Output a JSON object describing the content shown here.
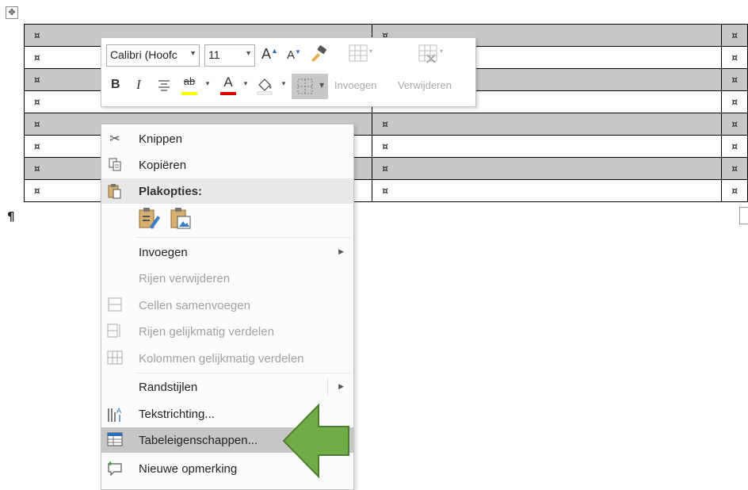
{
  "table": {
    "cell_mark": "¤",
    "rows": [
      {
        "shaded": true,
        "cells": [
          "¤",
          "¤",
          "¤"
        ]
      },
      {
        "shaded": false,
        "cells": [
          "¤",
          "¤",
          "¤"
        ]
      },
      {
        "shaded": true,
        "cells": [
          "¤",
          "¤",
          "¤"
        ]
      },
      {
        "shaded": false,
        "cells": [
          "¤",
          "¤",
          "¤"
        ]
      },
      {
        "shaded": true,
        "cells": [
          "¤",
          "¤",
          "¤"
        ]
      },
      {
        "shaded": false,
        "cells": [
          "¤",
          "¤",
          "¤"
        ]
      },
      {
        "shaded": true,
        "cells": [
          "¤",
          "¤",
          "¤"
        ]
      },
      {
        "shaded": false,
        "cells": [
          "¤",
          "¤",
          "¤"
        ]
      }
    ]
  },
  "document": {
    "pilcrow": "¶",
    "move_handle": "✥"
  },
  "mini_toolbar": {
    "font_name": "Calibri (Hoofc",
    "font_size": "11",
    "grow_font": "A",
    "shrink_font": "A",
    "bold": "B",
    "italic": "I",
    "font_color_letter": "A",
    "highlight_letters": "ab",
    "insert_label": "Invoegen",
    "delete_label": "Verwijderen",
    "highlight_color": "#ffff00",
    "font_color": "#e00000"
  },
  "context_menu": {
    "items": [
      {
        "label": "Knippen",
        "icon": "scissors-icon",
        "disabled": false
      },
      {
        "label": "Kopiëren",
        "icon": "copy-icon",
        "disabled": false
      },
      {
        "label": "Plakopties:",
        "icon": "paste-icon",
        "header": true
      },
      {
        "label": "Invoegen",
        "submenu": true,
        "disabled": false
      },
      {
        "label": "Rijen verwijderen",
        "disabled": true
      },
      {
        "label": "Cellen samenvoegen",
        "icon": "merge-cells-icon",
        "disabled": true
      },
      {
        "label": "Rijen gelijkmatig verdelen",
        "icon": "distribute-rows-icon",
        "disabled": true
      },
      {
        "label": "Kolommen gelijkmatig verdelen",
        "icon": "distribute-columns-icon",
        "disabled": true
      },
      {
        "label": "Randstijlen",
        "submenu": true,
        "disabled": false
      },
      {
        "label": "Tekstrichting...",
        "icon": "text-direction-icon",
        "disabled": false
      },
      {
        "label": "Tabeleigenschappen...",
        "icon": "table-properties-icon",
        "disabled": false,
        "highlighted": true
      },
      {
        "label": "Nieuwe opmerking",
        "icon": "new-comment-icon",
        "disabled": false
      }
    ],
    "arrow_color": "#70ad47"
  }
}
